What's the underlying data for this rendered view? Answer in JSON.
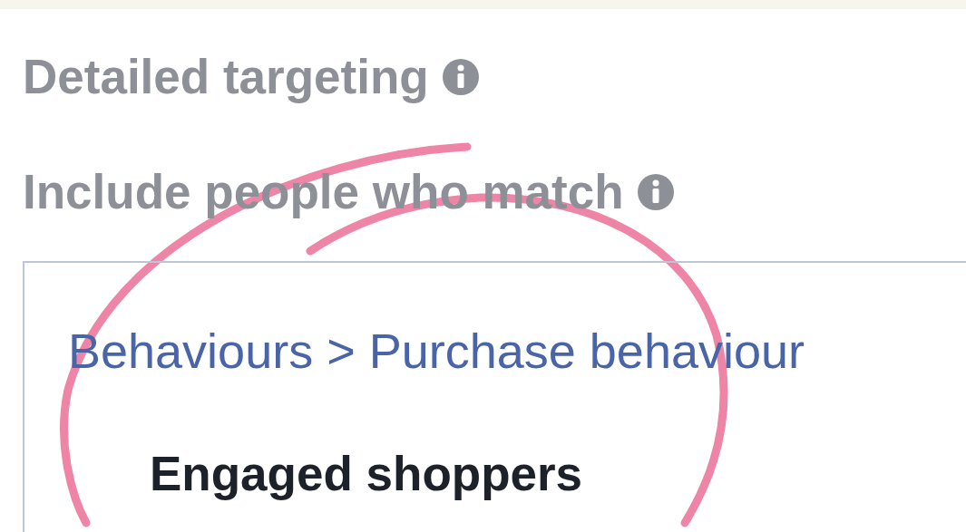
{
  "section": {
    "title": "Detailed targeting"
  },
  "include": {
    "label": "Include people who match"
  },
  "criteria": {
    "path": "Behaviours > Purchase behaviour",
    "items": [
      "Engaged shoppers"
    ]
  }
}
